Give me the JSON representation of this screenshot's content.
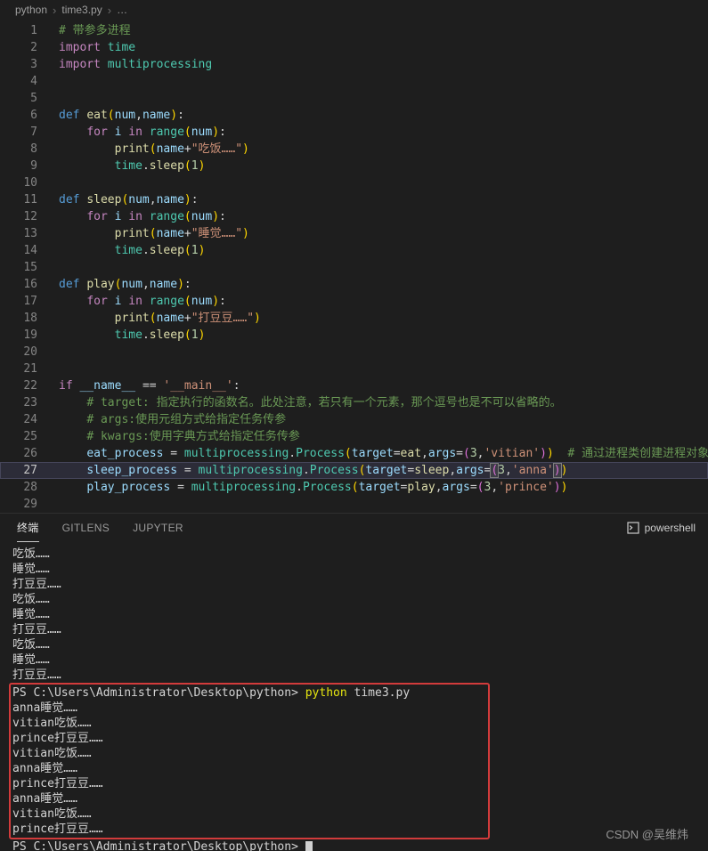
{
  "breadcrumb": {
    "items": [
      "python",
      "time3.py",
      "…"
    ],
    "separator": "›"
  },
  "editor": {
    "current_line": 27,
    "lines": [
      {
        "num": 1,
        "tokens": [
          [
            "c",
            "# 带参多进程"
          ]
        ]
      },
      {
        "num": 2,
        "tokens": [
          [
            "k",
            "import"
          ],
          [
            "t",
            " "
          ],
          [
            "m",
            "time"
          ]
        ]
      },
      {
        "num": 3,
        "tokens": [
          [
            "k",
            "import"
          ],
          [
            "t",
            " "
          ],
          [
            "m",
            "multiprocessing"
          ]
        ]
      },
      {
        "num": 4,
        "tokens": []
      },
      {
        "num": 5,
        "tokens": []
      },
      {
        "num": 6,
        "tokens": [
          [
            "kd",
            "def"
          ],
          [
            "t",
            " "
          ],
          [
            "f",
            "eat"
          ],
          [
            "p1",
            "("
          ],
          [
            "v",
            "num"
          ],
          [
            "o",
            ","
          ],
          [
            "v",
            "name"
          ],
          [
            "p1",
            ")"
          ],
          [
            "o",
            ":"
          ]
        ]
      },
      {
        "num": 7,
        "tokens": [
          [
            "t",
            "    "
          ],
          [
            "k",
            "for"
          ],
          [
            "t",
            " "
          ],
          [
            "v",
            "i"
          ],
          [
            "t",
            " "
          ],
          [
            "k",
            "in"
          ],
          [
            "t",
            " "
          ],
          [
            "m",
            "range"
          ],
          [
            "p1",
            "("
          ],
          [
            "v",
            "num"
          ],
          [
            "p1",
            ")"
          ],
          [
            "o",
            ":"
          ]
        ]
      },
      {
        "num": 8,
        "tokens": [
          [
            "t",
            "        "
          ],
          [
            "f",
            "print"
          ],
          [
            "p1",
            "("
          ],
          [
            "v",
            "name"
          ],
          [
            "o",
            "+"
          ],
          [
            "s",
            "\"吃饭……\""
          ],
          [
            "p1",
            ")"
          ]
        ]
      },
      {
        "num": 9,
        "tokens": [
          [
            "t",
            "        "
          ],
          [
            "m",
            "time"
          ],
          [
            "o",
            "."
          ],
          [
            "f",
            "sleep"
          ],
          [
            "p1",
            "("
          ],
          [
            "n",
            "1"
          ],
          [
            "p1",
            ")"
          ]
        ]
      },
      {
        "num": 10,
        "tokens": []
      },
      {
        "num": 11,
        "tokens": [
          [
            "kd",
            "def"
          ],
          [
            "t",
            " "
          ],
          [
            "f",
            "sleep"
          ],
          [
            "p1",
            "("
          ],
          [
            "v",
            "num"
          ],
          [
            "o",
            ","
          ],
          [
            "v",
            "name"
          ],
          [
            "p1",
            ")"
          ],
          [
            "o",
            ":"
          ]
        ]
      },
      {
        "num": 12,
        "tokens": [
          [
            "t",
            "    "
          ],
          [
            "k",
            "for"
          ],
          [
            "t",
            " "
          ],
          [
            "v",
            "i"
          ],
          [
            "t",
            " "
          ],
          [
            "k",
            "in"
          ],
          [
            "t",
            " "
          ],
          [
            "m",
            "range"
          ],
          [
            "p1",
            "("
          ],
          [
            "v",
            "num"
          ],
          [
            "p1",
            ")"
          ],
          [
            "o",
            ":"
          ]
        ]
      },
      {
        "num": 13,
        "tokens": [
          [
            "t",
            "        "
          ],
          [
            "f",
            "print"
          ],
          [
            "p1",
            "("
          ],
          [
            "v",
            "name"
          ],
          [
            "o",
            "+"
          ],
          [
            "s",
            "\"睡觉……\""
          ],
          [
            "p1",
            ")"
          ]
        ]
      },
      {
        "num": 14,
        "tokens": [
          [
            "t",
            "        "
          ],
          [
            "m",
            "time"
          ],
          [
            "o",
            "."
          ],
          [
            "f",
            "sleep"
          ],
          [
            "p1",
            "("
          ],
          [
            "n",
            "1"
          ],
          [
            "p1",
            ")"
          ]
        ]
      },
      {
        "num": 15,
        "tokens": []
      },
      {
        "num": 16,
        "tokens": [
          [
            "kd",
            "def"
          ],
          [
            "t",
            " "
          ],
          [
            "f",
            "play"
          ],
          [
            "p1",
            "("
          ],
          [
            "v",
            "num"
          ],
          [
            "o",
            ","
          ],
          [
            "v",
            "name"
          ],
          [
            "p1",
            ")"
          ],
          [
            "o",
            ":"
          ]
        ]
      },
      {
        "num": 17,
        "tokens": [
          [
            "t",
            "    "
          ],
          [
            "k",
            "for"
          ],
          [
            "t",
            " "
          ],
          [
            "v",
            "i"
          ],
          [
            "t",
            " "
          ],
          [
            "k",
            "in"
          ],
          [
            "t",
            " "
          ],
          [
            "m",
            "range"
          ],
          [
            "p1",
            "("
          ],
          [
            "v",
            "num"
          ],
          [
            "p1",
            ")"
          ],
          [
            "o",
            ":"
          ]
        ]
      },
      {
        "num": 18,
        "tokens": [
          [
            "t",
            "        "
          ],
          [
            "f",
            "print"
          ],
          [
            "p1",
            "("
          ],
          [
            "v",
            "name"
          ],
          [
            "o",
            "+"
          ],
          [
            "s",
            "\"打豆豆……\""
          ],
          [
            "p1",
            ")"
          ]
        ]
      },
      {
        "num": 19,
        "tokens": [
          [
            "t",
            "        "
          ],
          [
            "m",
            "time"
          ],
          [
            "o",
            "."
          ],
          [
            "f",
            "sleep"
          ],
          [
            "p1",
            "("
          ],
          [
            "n",
            "1"
          ],
          [
            "p1",
            ")"
          ]
        ]
      },
      {
        "num": 20,
        "tokens": []
      },
      {
        "num": 21,
        "tokens": []
      },
      {
        "num": 22,
        "tokens": [
          [
            "k",
            "if"
          ],
          [
            "t",
            " "
          ],
          [
            "v",
            "__name__"
          ],
          [
            "t",
            " "
          ],
          [
            "o",
            "=="
          ],
          [
            "t",
            " "
          ],
          [
            "s",
            "'__main__'"
          ],
          [
            "o",
            ":"
          ]
        ]
      },
      {
        "num": 23,
        "tokens": [
          [
            "t",
            "    "
          ],
          [
            "c",
            "# target: 指定执行的函数名。此处注意，若只有一个元素，那个逗号也是不可以省略的。"
          ]
        ]
      },
      {
        "num": 24,
        "tokens": [
          [
            "t",
            "    "
          ],
          [
            "c",
            "# args:使用元组方式给指定任务传参"
          ]
        ]
      },
      {
        "num": 25,
        "tokens": [
          [
            "t",
            "    "
          ],
          [
            "c",
            "# kwargs:使用字典方式给指定任务传参"
          ]
        ]
      },
      {
        "num": 26,
        "tokens": [
          [
            "t",
            "    "
          ],
          [
            "v",
            "eat_process"
          ],
          [
            "t",
            " "
          ],
          [
            "o",
            "="
          ],
          [
            "t",
            " "
          ],
          [
            "m",
            "multiprocessing"
          ],
          [
            "o",
            "."
          ],
          [
            "m",
            "Process"
          ],
          [
            "p1",
            "("
          ],
          [
            "v",
            "target"
          ],
          [
            "o",
            "="
          ],
          [
            "f",
            "eat"
          ],
          [
            "o",
            ","
          ],
          [
            "v",
            "args"
          ],
          [
            "o",
            "="
          ],
          [
            "p2",
            "("
          ],
          [
            "n",
            "3"
          ],
          [
            "o",
            ","
          ],
          [
            "s",
            "'vitian'"
          ],
          [
            "p2",
            ")"
          ],
          [
            "p1",
            ")"
          ],
          [
            "t",
            "  "
          ],
          [
            "c",
            "# 通过进程类创建进程对象"
          ]
        ]
      },
      {
        "num": 27,
        "tokens": [
          [
            "t",
            "    "
          ],
          [
            "v",
            "sleep_process"
          ],
          [
            "t",
            " "
          ],
          [
            "o",
            "="
          ],
          [
            "t",
            " "
          ],
          [
            "m",
            "multiprocessing"
          ],
          [
            "o",
            "."
          ],
          [
            "m",
            "Process"
          ],
          [
            "p1",
            "("
          ],
          [
            "v",
            "target"
          ],
          [
            "o",
            "="
          ],
          [
            "f",
            "sleep"
          ],
          [
            "o",
            ","
          ],
          [
            "v",
            "args"
          ],
          [
            "o",
            "="
          ],
          [
            "pm",
            "("
          ],
          [
            "n",
            "3"
          ],
          [
            "o",
            ","
          ],
          [
            "s",
            "'anna'"
          ],
          [
            "pm",
            ")"
          ],
          [
            "p1",
            ")"
          ]
        ]
      },
      {
        "num": 28,
        "tokens": [
          [
            "t",
            "    "
          ],
          [
            "v",
            "play_process"
          ],
          [
            "t",
            " "
          ],
          [
            "o",
            "="
          ],
          [
            "t",
            " "
          ],
          [
            "m",
            "multiprocessing"
          ],
          [
            "o",
            "."
          ],
          [
            "m",
            "Process"
          ],
          [
            "p1",
            "("
          ],
          [
            "v",
            "target"
          ],
          [
            "o",
            "="
          ],
          [
            "f",
            "play"
          ],
          [
            "o",
            ","
          ],
          [
            "v",
            "args"
          ],
          [
            "o",
            "="
          ],
          [
            "p2",
            "("
          ],
          [
            "n",
            "3"
          ],
          [
            "o",
            ","
          ],
          [
            "s",
            "'prince'"
          ],
          [
            "p2",
            ")"
          ],
          [
            "p1",
            ")"
          ]
        ]
      },
      {
        "num": 29,
        "tokens": []
      }
    ]
  },
  "panel": {
    "tabs": [
      "终端",
      "GITLENS",
      "JUPYTER"
    ],
    "shell_label": "powershell"
  },
  "terminal": {
    "pre_lines": [
      [
        [
          "t",
          "吃饭……"
        ]
      ],
      [
        [
          "t",
          "睡觉……"
        ]
      ],
      [
        [
          "t",
          "打豆豆……"
        ]
      ],
      [
        [
          "t",
          "吃饭……"
        ]
      ],
      [
        [
          "t",
          "睡觉……"
        ]
      ],
      [
        [
          "t",
          "打豆豆……"
        ]
      ],
      [
        [
          "t",
          "吃饭……"
        ]
      ],
      [
        [
          "t",
          "睡觉……"
        ]
      ],
      [
        [
          "t",
          "打豆豆……"
        ]
      ]
    ],
    "box_lines": [
      [
        [
          "t",
          "PS C:\\Users\\Administrator\\Desktop\\python> "
        ],
        [
          "cmd",
          "python"
        ],
        [
          "t",
          " time3.py"
        ]
      ],
      [
        [
          "t",
          "anna睡觉……"
        ]
      ],
      [
        [
          "t",
          "vitian吃饭……"
        ]
      ],
      [
        [
          "t",
          "prince打豆豆……"
        ]
      ],
      [
        [
          "t",
          "vitian吃饭……"
        ]
      ],
      [
        [
          "t",
          "anna睡觉……"
        ]
      ],
      [
        [
          "t",
          "prince打豆豆……"
        ]
      ],
      [
        [
          "t",
          "anna睡觉……"
        ]
      ],
      [
        [
          "t",
          "vitian吃饭……"
        ]
      ],
      [
        [
          "t",
          "prince打豆豆……"
        ]
      ]
    ],
    "post_lines": [
      [
        [
          "t",
          "PS C:\\Users\\Administrator\\Desktop\\python> "
        ],
        [
          "cursor",
          " "
        ]
      ]
    ]
  },
  "watermark": "CSDN @吴维炜",
  "colors": {
    "background": "#1e1e1e",
    "annotation_box": "#d23b3b",
    "tab_active_underline": "#cccccc"
  }
}
